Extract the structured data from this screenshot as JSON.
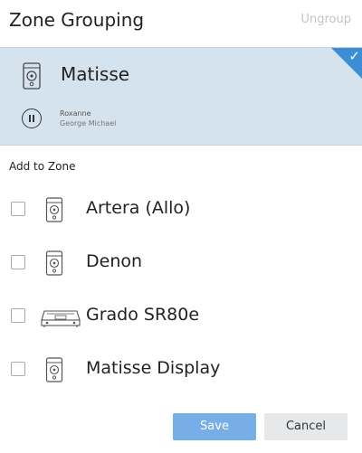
{
  "header": {
    "title": "Zone Grouping",
    "ungroup_label": "Ungroup"
  },
  "current_zone": {
    "name": "Matisse",
    "icon": "speaker-icon",
    "selected": true,
    "now_playing": {
      "track": "Roxanne",
      "artist": "George Michael",
      "state": "playing"
    }
  },
  "add_section": {
    "label": "Add to Zone",
    "zones": [
      {
        "name": "Artera (Allo)",
        "icon": "speaker-icon",
        "checked": false
      },
      {
        "name": "Denon",
        "icon": "speaker-icon",
        "checked": false
      },
      {
        "name": "Grado SR80e",
        "icon": "receiver-icon",
        "checked": false
      },
      {
        "name": "Matisse Display",
        "icon": "speaker-icon",
        "checked": false
      }
    ]
  },
  "buttons": {
    "save": "Save",
    "cancel": "Cancel"
  },
  "colors": {
    "selected_bg": "#d5e3ef",
    "accent": "#3b8ed6",
    "save_bg": "#78aee8",
    "cancel_bg": "#e6e8ea",
    "muted": "#c4c4c4"
  }
}
